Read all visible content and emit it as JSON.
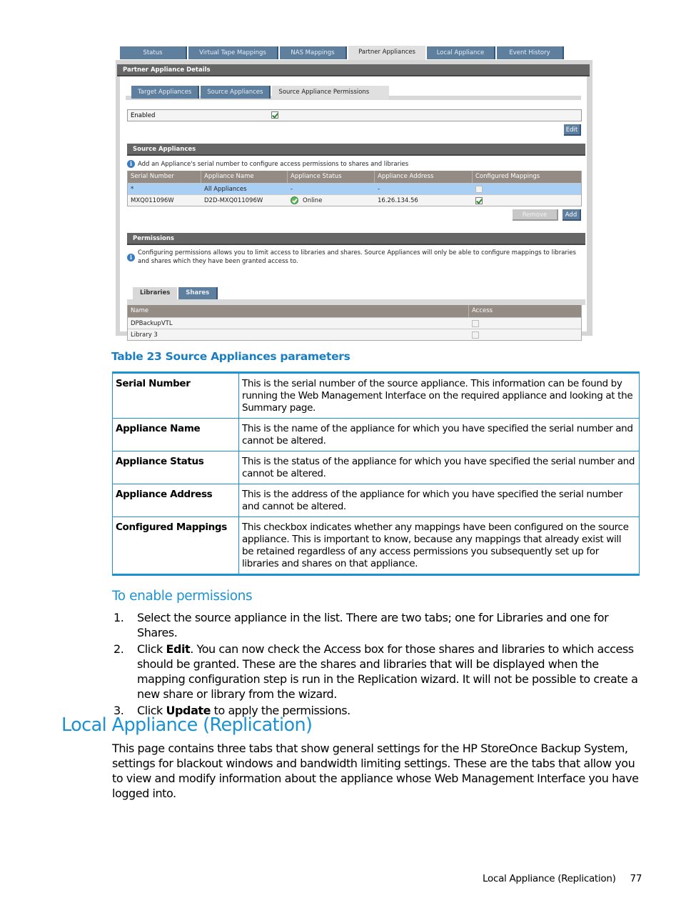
{
  "ui": {
    "top_tabs": [
      "Status",
      "Virtual Tape Mappings",
      "NAS Mappings",
      "Partner Appliances",
      "Local Appliance",
      "Event History"
    ],
    "active_top_tab": "Partner Appliances",
    "details_title": "Partner Appliance Details",
    "sub_tabs": [
      "Target Appliances",
      "Source Appliances",
      "Source Appliance Permissions"
    ],
    "active_sub_tab": "Source Appliance Permissions",
    "enabled_label": "Enabled",
    "enabled_checked": true,
    "edit_button": "Edit",
    "source_appliances": {
      "title": "Source Appliances",
      "info": "Add an Appliance's serial number to configure access permissions to shares and libraries",
      "columns": [
        "Serial Number",
        "Appliance Name",
        "Appliance Status",
        "Appliance Address",
        "Configured Mappings"
      ],
      "rows": [
        {
          "serial": "*",
          "name": "All Appliances",
          "status": "-",
          "address": "-",
          "configured": false,
          "selected": true
        },
        {
          "serial": "MXQ011096W",
          "name": "D2D-MXQ011096W",
          "status": "Online",
          "address": "16.26.134.56",
          "configured": true,
          "selected": false
        }
      ],
      "remove_button": "Remove",
      "add_button": "Add"
    },
    "permissions": {
      "title": "Permissions",
      "info": "Configuring permissions allows you to limit access to libraries and shares. Source Appliances will only be able to configure mappings to libraries and shares which they have been granted access to.",
      "tabs": [
        "Libraries",
        "Shares"
      ],
      "active_tab": "Libraries",
      "columns": [
        "Name",
        "Access"
      ],
      "rows": [
        {
          "name": "DPBackupVTL",
          "access": false
        },
        {
          "name": "Library 3",
          "access": false
        }
      ]
    }
  },
  "doc": {
    "table_caption": "Table 23 Source Appliances parameters",
    "parameters": [
      {
        "key": "Serial Number",
        "value": "This is the serial number of the source appliance. This information can be found by running the Web Management Interface on the required appliance and looking at the Summary page."
      },
      {
        "key": "Appliance Name",
        "value": "This is the name of the appliance for which you have specified the serial number and cannot be altered."
      },
      {
        "key": "Appliance Status",
        "value": "This is the status of the appliance for which you have specified the serial number and cannot be altered."
      },
      {
        "key": "Appliance Address",
        "value": "This is the address of the appliance for which you have specified the serial number and cannot be altered."
      },
      {
        "key": "Configured Mappings",
        "value": "This checkbox indicates whether any mappings have been configured on the source appliance. This is important to know, because any mappings that already exist will be retained regardless of any access permissions you subsequently set up for libraries and shares on that appliance."
      }
    ],
    "procedure_heading": "To enable permissions",
    "steps": [
      {
        "num": "1.",
        "pre": "Select the source appliance in the list. There are two tabs; one for Libraries and one for Shares.",
        "bold": "",
        "post": ""
      },
      {
        "num": "2.",
        "pre": "Click ",
        "bold": "Edit",
        "post": ". You can now check the Access box for those shares and libraries to which access should be granted. These are the shares and libraries that will be displayed when the mapping configuration step is run in the Replication wizard. It will not be possible to create a new share or library from the wizard."
      },
      {
        "num": "3.",
        "pre": "Click ",
        "bold": "Update",
        "post": " to apply the permissions."
      }
    ],
    "section_heading": "Local Appliance (Replication)",
    "section_paragraph": "This page contains three tabs that show general settings for the HP StoreOnce Backup System, settings for blackout windows and bandwidth limiting settings. These are the tabs that allow you to view and modify information about the appliance whose Web Management Interface you have logged into.",
    "footer_title": "Local Appliance (Replication)",
    "page_number": "77"
  }
}
